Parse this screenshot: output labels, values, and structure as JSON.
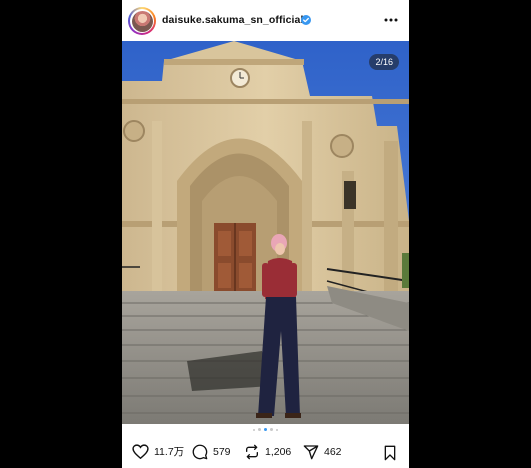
{
  "header": {
    "username": "daisuke.sakuma_sn_official",
    "verified_icon": "verified-badge-icon",
    "more_icon": "more-horizontal-icon"
  },
  "photo": {
    "counter": "2/16",
    "page_index": 2,
    "page_total": 16
  },
  "actions": {
    "likes": "11.7万",
    "comments": "579",
    "reposts": "1,206",
    "shares": "462"
  },
  "colors": {
    "verified": "#3897f0",
    "active_dot": "#3897f0"
  }
}
